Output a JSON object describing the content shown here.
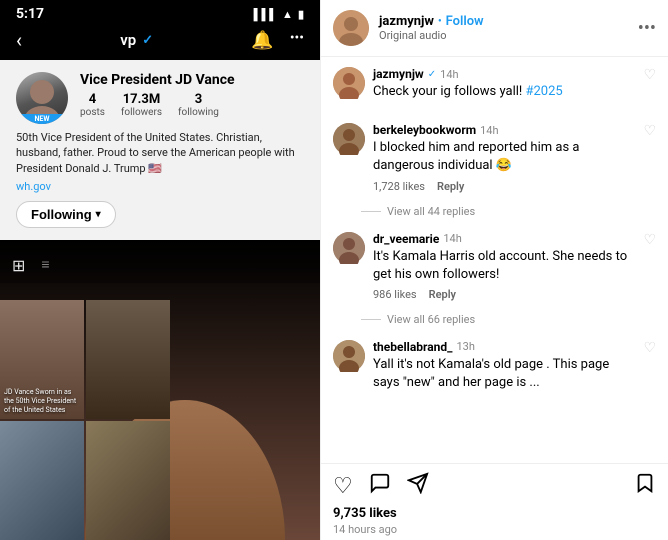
{
  "left": {
    "status_time": "5:17",
    "back_label": "‹",
    "nav_username": "vp",
    "verified": "✓",
    "bell_icon": "🔔",
    "more_icon": "•••",
    "profile_name": "Vice President JD Vance",
    "stat_posts_num": "4",
    "stat_posts_label": "posts",
    "stat_followers_num": "17.3M",
    "stat_followers_label": "followers",
    "stat_following_num": "3",
    "stat_following_label": "following",
    "new_badge": "NEW",
    "bio": "50th Vice President of the United States. Christian, husband, father. Proud to serve the American people with President Donald J. Trump 🇺🇸",
    "link": "wh.gov",
    "following_btn": "Following",
    "thumb1_label": "JD Vance Sworn in as the 50th Vice President of the United States",
    "thumb2_label": ""
  },
  "right": {
    "username": "jazmynjw",
    "blue_dot": "•",
    "follow_label": "Follow",
    "subtitle": "Original audio",
    "more_icon": "•••",
    "avatar_emoji": "👩🏾",
    "comments": [
      {
        "username": "jazmynjw",
        "verified": true,
        "time": "14h",
        "text": "Check your ig follows yall! #2025",
        "hashtag": "#2025",
        "likes": "",
        "reply": "",
        "has_heart": false,
        "show_replies": false,
        "avatar_emoji": "👩🏾"
      },
      {
        "username": "berkeleybookworm",
        "verified": false,
        "time": "14h",
        "text": "I blocked him and reported him as a dangerous individual 😂",
        "likes": "1,728 likes",
        "reply": "Reply",
        "has_heart": true,
        "show_replies": true,
        "replies_label": "View all 44 replies",
        "avatar_emoji": "👩"
      },
      {
        "username": "dr_veemarie",
        "verified": false,
        "time": "14h",
        "text": "It's Kamala Harris old account. She needs to get his own followers!",
        "likes": "986 likes",
        "reply": "Reply",
        "has_heart": true,
        "show_replies": true,
        "replies_label": "View all 66 replies",
        "avatar_emoji": "👩🏽"
      },
      {
        "username": "thebellabrand_",
        "verified": false,
        "time": "13h",
        "text": "Yall it's not Kamala's old page . This page says \"new\" and her page is ...",
        "likes": "",
        "reply": "",
        "has_heart": true,
        "show_replies": false,
        "avatar_emoji": "👩🏾"
      }
    ],
    "likes_total": "9,735 likes",
    "post_time": "14 hours ago"
  }
}
